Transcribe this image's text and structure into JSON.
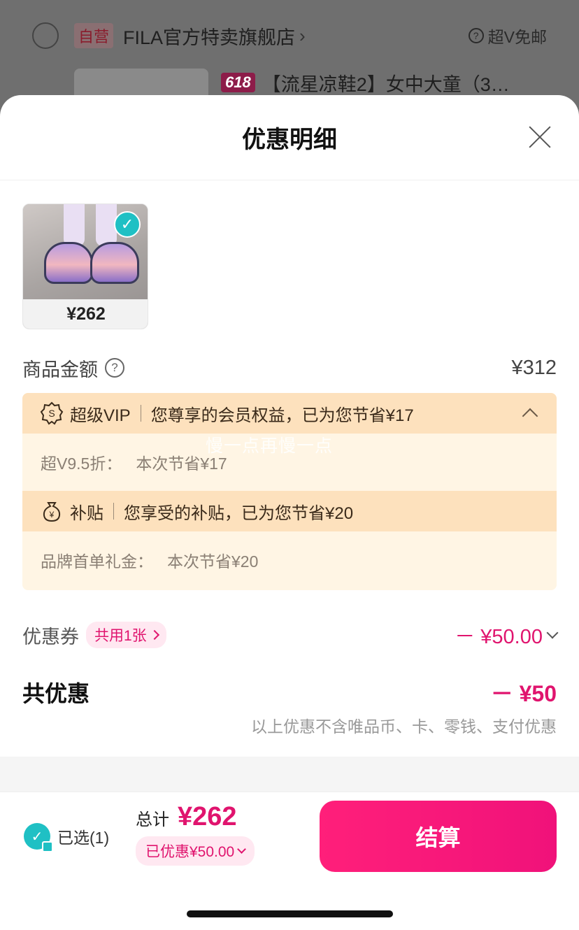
{
  "background": {
    "store_tag": "自营",
    "store_name": "FILA官方特卖旗舰店",
    "help_label": "超V免邮",
    "promo_badge": "618",
    "product_title": "【流星凉鞋2】女中大童（3…"
  },
  "sheet": {
    "title": "优惠明细",
    "product": {
      "price": "¥262",
      "selected": true
    },
    "goods_amount": {
      "label": "商品金额",
      "value": "¥312"
    },
    "benefits": [
      {
        "icon": "vip-badge-icon",
        "name": "超级VIP",
        "desc": "您尊享的会员权益，已为您节省¥17",
        "detail_key": "超V9.5折：",
        "detail_value": "本次节省¥17",
        "expanded": true
      },
      {
        "icon": "money-bag-icon",
        "name": "补贴",
        "desc": "您享受的补贴，已为您节省¥20",
        "detail_key": "品牌首单礼金：",
        "detail_value": "本次节省¥20"
      }
    ],
    "watermark": "慢一点再慢一点",
    "coupon": {
      "label": "优惠券",
      "pill": "共用1张",
      "value": "－ ¥50.00"
    },
    "total_discount": {
      "label": "共优惠",
      "value": "－ ¥50",
      "note": "以上优惠不含唯品币、卡、零钱、支付优惠"
    }
  },
  "footer": {
    "selected_label": "已选(1)",
    "total_label": "总计",
    "total_value": "¥262",
    "saved_label": "已优惠¥50.00",
    "checkout_label": "结算"
  },
  "colors": {
    "accent": "#e0146e",
    "teal": "#1fc0c4",
    "benefit_bg": "#fff5e4",
    "benefit_head": "#fde1bd"
  }
}
